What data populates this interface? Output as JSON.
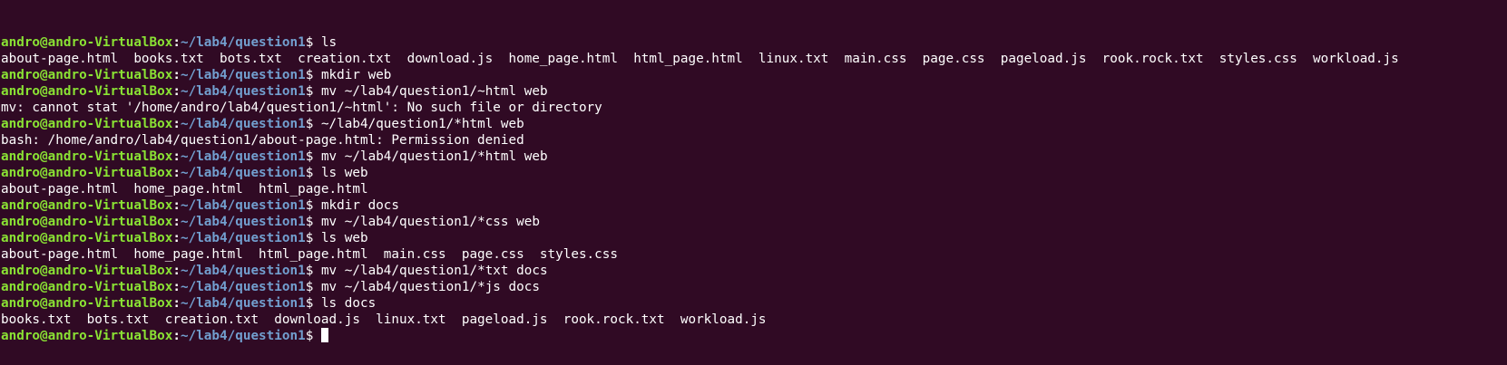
{
  "prompt": {
    "user_host": "andro@andro-VirtualBox",
    "colon": ":",
    "path": "~/lab4/question1",
    "symbol": "$ "
  },
  "lines": [
    {
      "type": "cmd",
      "text": "ls"
    },
    {
      "type": "out",
      "text": "about-page.html  books.txt  bots.txt  creation.txt  download.js  home_page.html  html_page.html  linux.txt  main.css  page.css  pageload.js  rook.rock.txt  styles.css  workload.js"
    },
    {
      "type": "cmd",
      "text": "mkdir web"
    },
    {
      "type": "cmd",
      "text": "mv ~/lab4/question1/~html web"
    },
    {
      "type": "out",
      "text": "mv: cannot stat '/home/andro/lab4/question1/~html': No such file or directory"
    },
    {
      "type": "cmd",
      "text": "~/lab4/question1/*html web"
    },
    {
      "type": "out",
      "text": "bash: /home/andro/lab4/question1/about-page.html: Permission denied"
    },
    {
      "type": "cmd",
      "text": "mv ~/lab4/question1/*html web"
    },
    {
      "type": "cmd",
      "text": "ls web"
    },
    {
      "type": "out",
      "text": "about-page.html  home_page.html  html_page.html"
    },
    {
      "type": "cmd",
      "text": "mkdir docs"
    },
    {
      "type": "cmd",
      "text": "mv ~/lab4/question1/*css web"
    },
    {
      "type": "cmd",
      "text": "ls web"
    },
    {
      "type": "out",
      "text": "about-page.html  home_page.html  html_page.html  main.css  page.css  styles.css"
    },
    {
      "type": "cmd",
      "text": "mv ~/lab4/question1/*txt docs"
    },
    {
      "type": "cmd",
      "text": "mv ~/lab4/question1/*js docs"
    },
    {
      "type": "cmd",
      "text": "ls docs"
    },
    {
      "type": "out",
      "text": "books.txt  bots.txt  creation.txt  download.js  linux.txt  pageload.js  rook.rock.txt  workload.js"
    },
    {
      "type": "cmd",
      "text": ""
    }
  ],
  "colors": {
    "background": "#300a24",
    "user_host": "#8ae234",
    "path": "#729fcf",
    "text": "#ffffff"
  }
}
